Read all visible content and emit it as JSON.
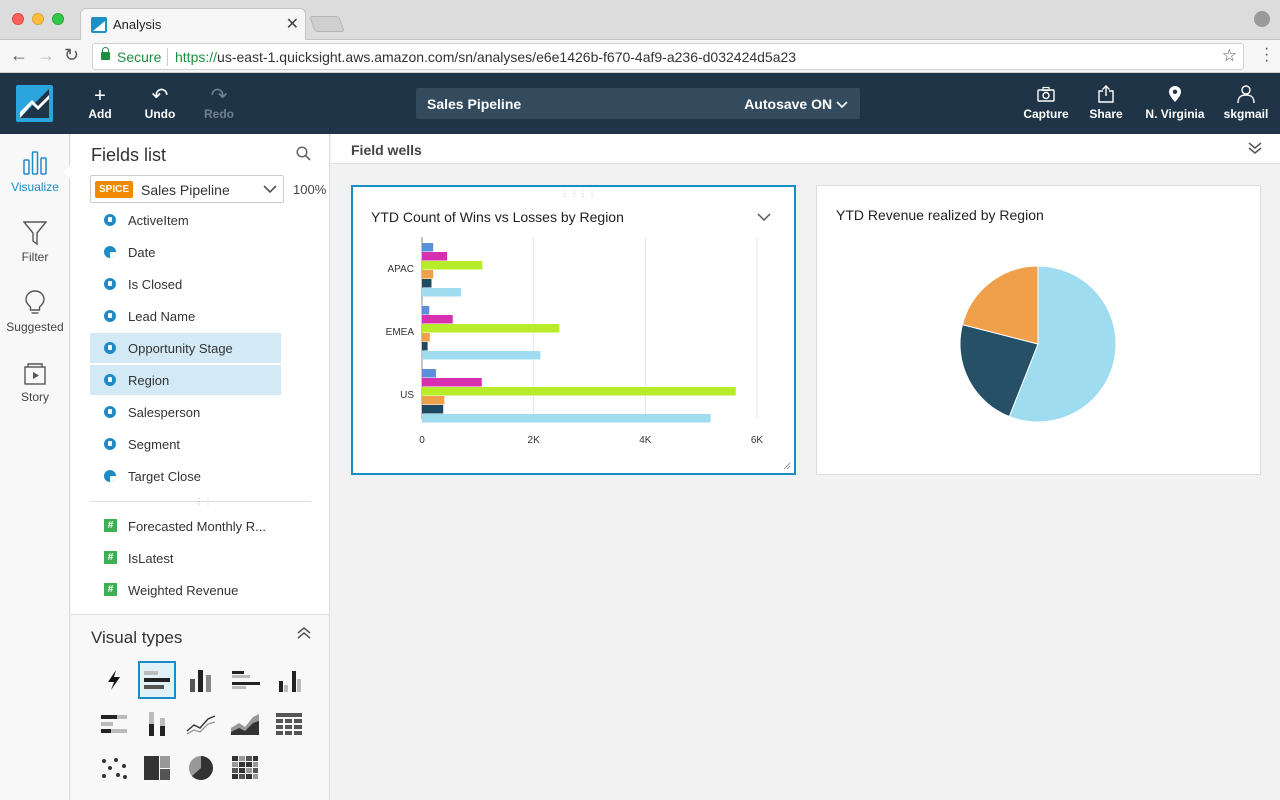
{
  "browser": {
    "tab_title": "Analysis",
    "secure_label": "Secure",
    "url_scheme": "https://",
    "url_rest": "us-east-1.quicksight.aws.amazon.com/sn/analyses/e6e1426b-f670-4af9-a236-d032424d5a23"
  },
  "header": {
    "add_label": "Add",
    "undo_label": "Undo",
    "redo_label": "Redo",
    "analysis_name": "Sales Pipeline",
    "autosave_label": "Autosave ON",
    "capture_label": "Capture",
    "share_label": "Share",
    "region_label": "N. Virginia",
    "user_label": "skgmail"
  },
  "rail": {
    "items": [
      {
        "label": "Visualize",
        "icon": "bar-chart-icon"
      },
      {
        "label": "Filter",
        "icon": "funnel-icon"
      },
      {
        "label": "Suggested",
        "icon": "lightbulb-icon"
      },
      {
        "label": "Story",
        "icon": "story-icon"
      }
    ]
  },
  "fields_panel": {
    "title": "Fields list",
    "dataset_badge": "SPICE",
    "dataset_name": "Sales Pipeline",
    "spice_percent": "100%",
    "dimensions": [
      {
        "label": "ActiveItem",
        "type": "string",
        "selected": false
      },
      {
        "label": "Date",
        "type": "date",
        "selected": false
      },
      {
        "label": "Is Closed",
        "type": "string",
        "selected": false
      },
      {
        "label": "Lead Name",
        "type": "string",
        "selected": false
      },
      {
        "label": "Opportunity Stage",
        "type": "string",
        "selected": true
      },
      {
        "label": "Region",
        "type": "string",
        "selected": true
      },
      {
        "label": "Salesperson",
        "type": "string",
        "selected": false
      },
      {
        "label": "Segment",
        "type": "string",
        "selected": false
      },
      {
        "label": "Target Close",
        "type": "date",
        "selected": false
      }
    ],
    "measures": [
      {
        "label": "Forecasted Monthly R...",
        "type": "number"
      },
      {
        "label": "IsLatest",
        "type": "number"
      },
      {
        "label": "Weighted Revenue",
        "type": "number"
      }
    ]
  },
  "visual_types": {
    "title": "Visual types"
  },
  "field_wells": {
    "label": "Field wells"
  },
  "colors": {
    "accent": "#1a8dc6",
    "header_bg": "#1f3446",
    "blue": "#5b8fdc",
    "magenta": "#d62fb0",
    "lime": "#b6ec2a",
    "orange": "#f0a04b",
    "navy": "#1f4a63",
    "light_blue": "#9fdcef",
    "teal": "#255068"
  },
  "chart_data": [
    {
      "type": "bar",
      "orientation": "horizontal",
      "title": "YTD Count of Wins vs Losses by Region",
      "categories": [
        "APAC",
        "EMEA",
        "US"
      ],
      "series": [
        {
          "values": [
            200,
            130,
            250
          ],
          "color": "#5b8fdc"
        },
        {
          "values": [
            450,
            550,
            1070
          ],
          "color": "#d62fb0"
        },
        {
          "values": [
            1080,
            2460,
            5620
          ],
          "color": "#b6ec2a"
        },
        {
          "values": [
            200,
            140,
            400
          ],
          "color": "#f0a04b"
        },
        {
          "values": [
            170,
            100,
            380
          ],
          "color": "#1f4a63"
        },
        {
          "values": [
            700,
            2120,
            5170
          ],
          "color": "#9fdcef"
        }
      ],
      "x_ticks": [
        "0",
        "2K",
        "4K",
        "6K"
      ],
      "xlim": [
        0,
        6000
      ],
      "grid": true
    },
    {
      "type": "pie",
      "title": "YTD Revenue realized by Region",
      "slices": [
        {
          "value": 56,
          "color": "#9fdcef"
        },
        {
          "value": 23,
          "color": "#255068"
        },
        {
          "value": 21,
          "color": "#f0a04b"
        }
      ]
    }
  ]
}
